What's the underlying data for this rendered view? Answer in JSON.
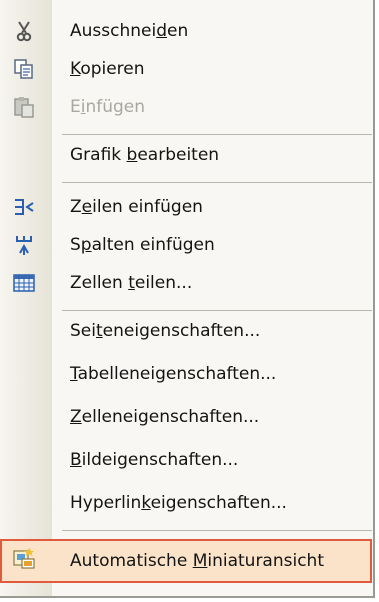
{
  "menu": {
    "items": [
      {
        "label": "Ausschneiden",
        "pre": "Ausschnei",
        "mn": "d",
        "post": "en",
        "icon": "scissors-icon",
        "enabled": true
      },
      {
        "label": "Kopieren",
        "pre": "",
        "mn": "K",
        "post": "opieren",
        "icon": "copy-icon",
        "enabled": true
      },
      {
        "label": "Einfügen",
        "pre": "E",
        "mn": "i",
        "post": "nfügen",
        "icon": "paste-icon",
        "enabled": false
      },
      {
        "label": "Grafik bearbeiten",
        "pre": "Grafik ",
        "mn": "b",
        "post": "earbeiten",
        "icon": "",
        "enabled": true
      },
      {
        "label": "Zeilen einfügen",
        "pre": "Z",
        "mn": "e",
        "post": "ilen einfügen",
        "icon": "insert-rows-icon",
        "enabled": true
      },
      {
        "label": "Spalten einfügen",
        "pre": "S",
        "mn": "p",
        "post": "alten einfügen",
        "icon": "insert-columns-icon",
        "enabled": true
      },
      {
        "label": "Zellen teilen...",
        "pre": "Zellen ",
        "mn": "t",
        "post": "eilen...",
        "icon": "split-cells-icon",
        "enabled": true
      },
      {
        "label": "Seiteneigenschaften...",
        "pre": "Sei",
        "mn": "t",
        "post": "eneigenschaften...",
        "icon": "",
        "enabled": true
      },
      {
        "label": "Tabelleneigenschaften...",
        "pre": "",
        "mn": "T",
        "post": "abelleneigenschaften...",
        "icon": "",
        "enabled": true
      },
      {
        "label": "Zelleneigenschaften...",
        "pre": "",
        "mn": "Z",
        "post": "elleneigenschaften...",
        "icon": "",
        "enabled": true
      },
      {
        "label": "Bildeigenschaften...",
        "pre": "",
        "mn": "B",
        "post": "ildeigenschaften...",
        "icon": "",
        "enabled": true
      },
      {
        "label": "Hyperlinkeigenschaften...",
        "pre": "Hyperlin",
        "mn": "k",
        "post": "eigenschaften...",
        "icon": "",
        "enabled": true
      },
      {
        "label": "Automatische Miniaturansicht",
        "pre": "Automatische ",
        "mn": "M",
        "post": "iniaturansicht",
        "icon": "thumbnail-icon",
        "enabled": true,
        "highlighted": true
      }
    ]
  },
  "colors": {
    "highlight_border": "#e05a3d",
    "highlight_fill": "#fbe3c9",
    "disabled_text": "#a8a8a0"
  }
}
